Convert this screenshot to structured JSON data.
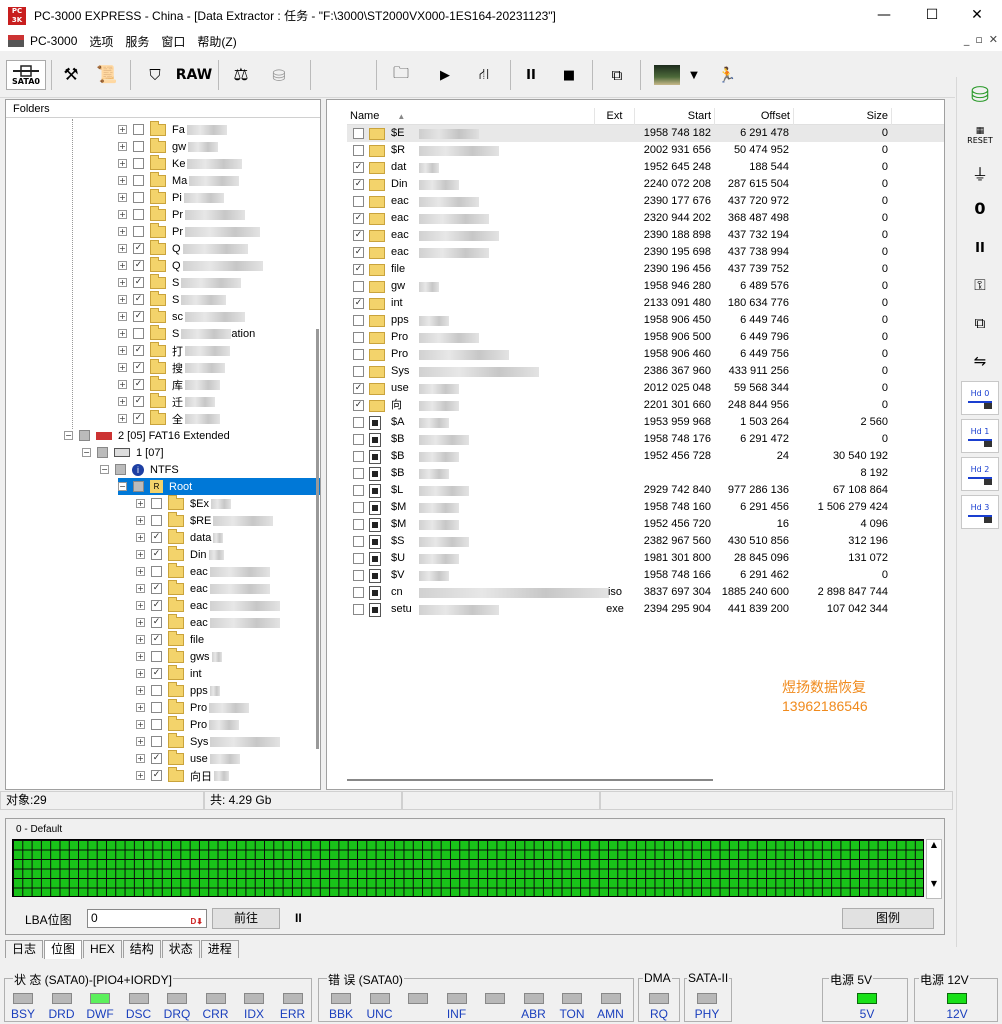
{
  "window": {
    "title": "PC-3000 EXPRESS - China - [Data Extractor : 任务 - \"F:\\3000\\ST2000VX000-1ES164-20231123\"]",
    "logo_text": "PC 3K",
    "minimize": "—",
    "maximize": "☐",
    "close": "✕"
  },
  "menu": {
    "items": [
      "PC-3000",
      "选项",
      "服务",
      "窗口",
      "帮助(Z)"
    ],
    "mdi_buttons": [
      "_",
      "▫",
      "✕"
    ]
  },
  "toolbar": {
    "sata_label": "SATA0",
    "raw_label": "RAW",
    "icons": [
      "sata-icon",
      "tools-icon",
      "scroll-icon",
      "binoculars-icon",
      "raw-icon",
      "scale-icon",
      "disk-icon",
      "folder-arrow-icon",
      "play-icon",
      "tree-arrow-icon",
      "pause-icon",
      "stop-icon",
      "windows-icon",
      "screenshot-icon",
      "run-icon"
    ]
  },
  "right_toolbar": {
    "reset_label": "RESET",
    "hd_buttons": [
      "Hd 0",
      "Hd 1",
      "Hd 2",
      "Hd 3"
    ]
  },
  "folder_panel": {
    "header": "Folders",
    "top_items": [
      {
        "label": "Fa",
        "checked": false
      },
      {
        "label": "gw",
        "checked": false
      },
      {
        "label": "Ke",
        "checked": false
      },
      {
        "label": "Ma",
        "checked": false
      },
      {
        "label": "Pi",
        "checked": false
      },
      {
        "label": "Pr",
        "checked": false
      },
      {
        "label": "Pr",
        "checked": false
      },
      {
        "label": "Q",
        "checked": true
      },
      {
        "label": "Q",
        "checked": true
      },
      {
        "label": "S",
        "checked": true
      },
      {
        "label": "S",
        "checked": true
      },
      {
        "label": "sc",
        "checked": true
      },
      {
        "label": "S",
        "checked": false,
        "suffix": "ation"
      },
      {
        "label": "打",
        "checked": true
      },
      {
        "label": "搜",
        "checked": true
      },
      {
        "label": "库",
        "checked": true
      },
      {
        "label": "迁",
        "checked": true
      },
      {
        "label": "全",
        "checked": true
      }
    ],
    "partition_label": "2 [05] FAT16 Extended",
    "disk_label": "1 [07]",
    "fs_label": "NTFS",
    "root_label": "Root",
    "root_items": [
      {
        "label": "$Ex",
        "checked": false
      },
      {
        "label": "$RE",
        "checked": false
      },
      {
        "label": "data",
        "checked": true
      },
      {
        "label": "Din",
        "checked": true
      },
      {
        "label": "eac",
        "checked": false
      },
      {
        "label": "eac",
        "checked": true
      },
      {
        "label": "eac",
        "checked": true
      },
      {
        "label": "eac",
        "checked": true
      },
      {
        "label": "file",
        "checked": true
      },
      {
        "label": "gws",
        "checked": false
      },
      {
        "label": "int",
        "checked": true
      },
      {
        "label": "pps",
        "checked": false
      },
      {
        "label": "Pro",
        "checked": false
      },
      {
        "label": "Pro",
        "checked": false
      },
      {
        "label": "Sys",
        "checked": false
      },
      {
        "label": "use",
        "checked": true
      },
      {
        "label": "向日",
        "checked": true
      }
    ]
  },
  "file_panel": {
    "columns": {
      "name": "Name",
      "ext": "Ext",
      "start": "Start",
      "offset": "Offset",
      "size": "Size"
    },
    "rows": [
      {
        "icon": "folder",
        "checked": false,
        "name": "$E",
        "ext": "",
        "start": "1958 748 182",
        "offset": "6 291 478",
        "size": "0"
      },
      {
        "icon": "folder",
        "checked": false,
        "name": "$R",
        "ext": "",
        "start": "2002 931 656",
        "offset": "50 474 952",
        "size": "0"
      },
      {
        "icon": "folder",
        "checked": true,
        "name": "dat",
        "ext": "",
        "start": "1952 645 248",
        "offset": "188 544",
        "size": "0"
      },
      {
        "icon": "folder",
        "checked": true,
        "name": "Din",
        "ext": "",
        "start": "2240 072 208",
        "offset": "287 615 504",
        "size": "0"
      },
      {
        "icon": "folder",
        "checked": false,
        "name": "eac",
        "ext": "",
        "start": "2390 177 676",
        "offset": "437 720 972",
        "size": "0"
      },
      {
        "icon": "folder",
        "checked": true,
        "name": "eac",
        "ext": "",
        "start": "2320 944 202",
        "offset": "368 487 498",
        "size": "0"
      },
      {
        "icon": "folder",
        "checked": true,
        "name": "eac",
        "ext": "",
        "start": "2390 188 898",
        "offset": "437 732 194",
        "size": "0"
      },
      {
        "icon": "folder",
        "checked": true,
        "name": "eac",
        "ext": "",
        "start": "2390 195 698",
        "offset": "437 738 994",
        "size": "0"
      },
      {
        "icon": "folder",
        "checked": true,
        "name": "file",
        "ext": "",
        "start": "2390 196 456",
        "offset": "437 739 752",
        "size": "0"
      },
      {
        "icon": "folder",
        "checked": false,
        "name": "gw",
        "ext": "",
        "start": "1958 946 280",
        "offset": "6 489 576",
        "size": "0"
      },
      {
        "icon": "folder",
        "checked": true,
        "name": "int",
        "ext": "",
        "start": "2133 091 480",
        "offset": "180 634 776",
        "size": "0"
      },
      {
        "icon": "folder",
        "checked": false,
        "name": "pps",
        "ext": "",
        "start": "1958 906 450",
        "offset": "6 449 746",
        "size": "0"
      },
      {
        "icon": "folder",
        "checked": false,
        "name": "Pro",
        "ext": "",
        "start": "1958 906 500",
        "offset": "6 449 796",
        "size": "0"
      },
      {
        "icon": "folder",
        "checked": false,
        "name": "Pro",
        "ext": "",
        "start": "1958 906 460",
        "offset": "6 449 756",
        "size": "0"
      },
      {
        "icon": "folder",
        "checked": false,
        "name": "Sys",
        "ext": "",
        "start": "2386 367 960",
        "offset": "433 911 256",
        "size": "0"
      },
      {
        "icon": "folder",
        "checked": true,
        "name": "use",
        "ext": "",
        "start": "2012 025 048",
        "offset": "59 568 344",
        "size": "0"
      },
      {
        "icon": "folder",
        "checked": true,
        "name": "向",
        "ext": "",
        "start": "2201 301 660",
        "offset": "248 844 956",
        "size": "0"
      },
      {
        "icon": "sysfile",
        "checked": false,
        "name": "$A",
        "ext": "",
        "start": "1953 959 968",
        "offset": "1 503 264",
        "size": "2 560"
      },
      {
        "icon": "sysfile",
        "checked": false,
        "name": "$B",
        "ext": "",
        "start": "1958 748 176",
        "offset": "6 291 472",
        "size": "0"
      },
      {
        "icon": "sysfile",
        "checked": false,
        "name": "$B",
        "ext": "",
        "start": "1952 456 728",
        "offset": "24",
        "size": "30 540 192"
      },
      {
        "icon": "sysfile",
        "checked": false,
        "name": "$B",
        "ext": "",
        "start": "",
        "offset": "",
        "size": "8 192"
      },
      {
        "icon": "sysfile",
        "checked": false,
        "name": "$L",
        "ext": "",
        "start": "2929 742 840",
        "offset": "977 286 136",
        "size": "67 108 864"
      },
      {
        "icon": "sysfile",
        "checked": false,
        "name": "$M",
        "ext": "",
        "start": "1958 748 160",
        "offset": "6 291 456",
        "size": "1 506 279 424"
      },
      {
        "icon": "sysfile",
        "checked": false,
        "name": "$M",
        "ext": "",
        "start": "1952 456 720",
        "offset": "16",
        "size": "4 096"
      },
      {
        "icon": "sysfile",
        "checked": false,
        "name": "$S",
        "ext": "",
        "start": "2382 967 560",
        "offset": "430 510 856",
        "size": "312 196"
      },
      {
        "icon": "sysfile",
        "checked": false,
        "name": "$U",
        "ext": "",
        "start": "1981 301 800",
        "offset": "28 845 096",
        "size": "131 072"
      },
      {
        "icon": "sysfile",
        "checked": false,
        "name": "$V",
        "ext": "",
        "start": "1958 748 166",
        "offset": "6 291 462",
        "size": "0"
      },
      {
        "icon": "file",
        "checked": false,
        "name": "cn",
        "ext": "iso",
        "start": "3837 697 304",
        "offset": "1885 240 600",
        "size": "2 898 847 744"
      },
      {
        "icon": "exe",
        "checked": false,
        "name": "setu",
        "ext": "exe",
        "start": "2394 295 904",
        "offset": "441 839 200",
        "size": "107 042 344"
      }
    ],
    "watermark_line1": "煜扬数据恢复",
    "watermark_line2": "13962186546"
  },
  "status": {
    "objects": "对象:29",
    "total": "共:  4.29 Gb"
  },
  "map": {
    "label": "0 - Default",
    "lba_label": "LBA位图",
    "lba_value": "0",
    "goto_label": "前往",
    "pause_label": "II",
    "legend_label": "图例"
  },
  "tabs": [
    {
      "label": "日志",
      "active": false
    },
    {
      "label": "位图",
      "active": true
    },
    {
      "label": "HEX",
      "active": false
    },
    {
      "label": "结构",
      "active": false
    },
    {
      "label": "状态",
      "active": false
    },
    {
      "label": "进程",
      "active": false
    }
  ],
  "indicators": {
    "status_group": "状 态 (SATA0)-[PIO4+IORDY]",
    "status_leds": [
      {
        "label": "BSY",
        "on": false
      },
      {
        "label": "DRD",
        "on": false
      },
      {
        "label": "DWF",
        "on": true
      },
      {
        "label": "DSC",
        "on": false
      },
      {
        "label": "DRQ",
        "on": false
      },
      {
        "label": "CRR",
        "on": false
      },
      {
        "label": "IDX",
        "on": false
      },
      {
        "label": "ERR",
        "on": false
      }
    ],
    "error_group": "错 误 (SATA0)",
    "error_leds": [
      {
        "label": "BBK",
        "on": false
      },
      {
        "label": "UNC",
        "on": false
      },
      {
        "label": "",
        "on": false
      },
      {
        "label": "INF",
        "on": false
      },
      {
        "label": "",
        "on": false
      },
      {
        "label": "ABR",
        "on": false
      },
      {
        "label": "TON",
        "on": false
      },
      {
        "label": "AMN",
        "on": false
      }
    ],
    "dma_group": "DMA",
    "dma_led": "RQ",
    "sata_group": "SATA-II",
    "sata_led": "PHY",
    "pwr5_group": "电源 5V",
    "pwr5_led": "5V",
    "pwr12_group": "电源 12V",
    "pwr12_led": "12V"
  }
}
